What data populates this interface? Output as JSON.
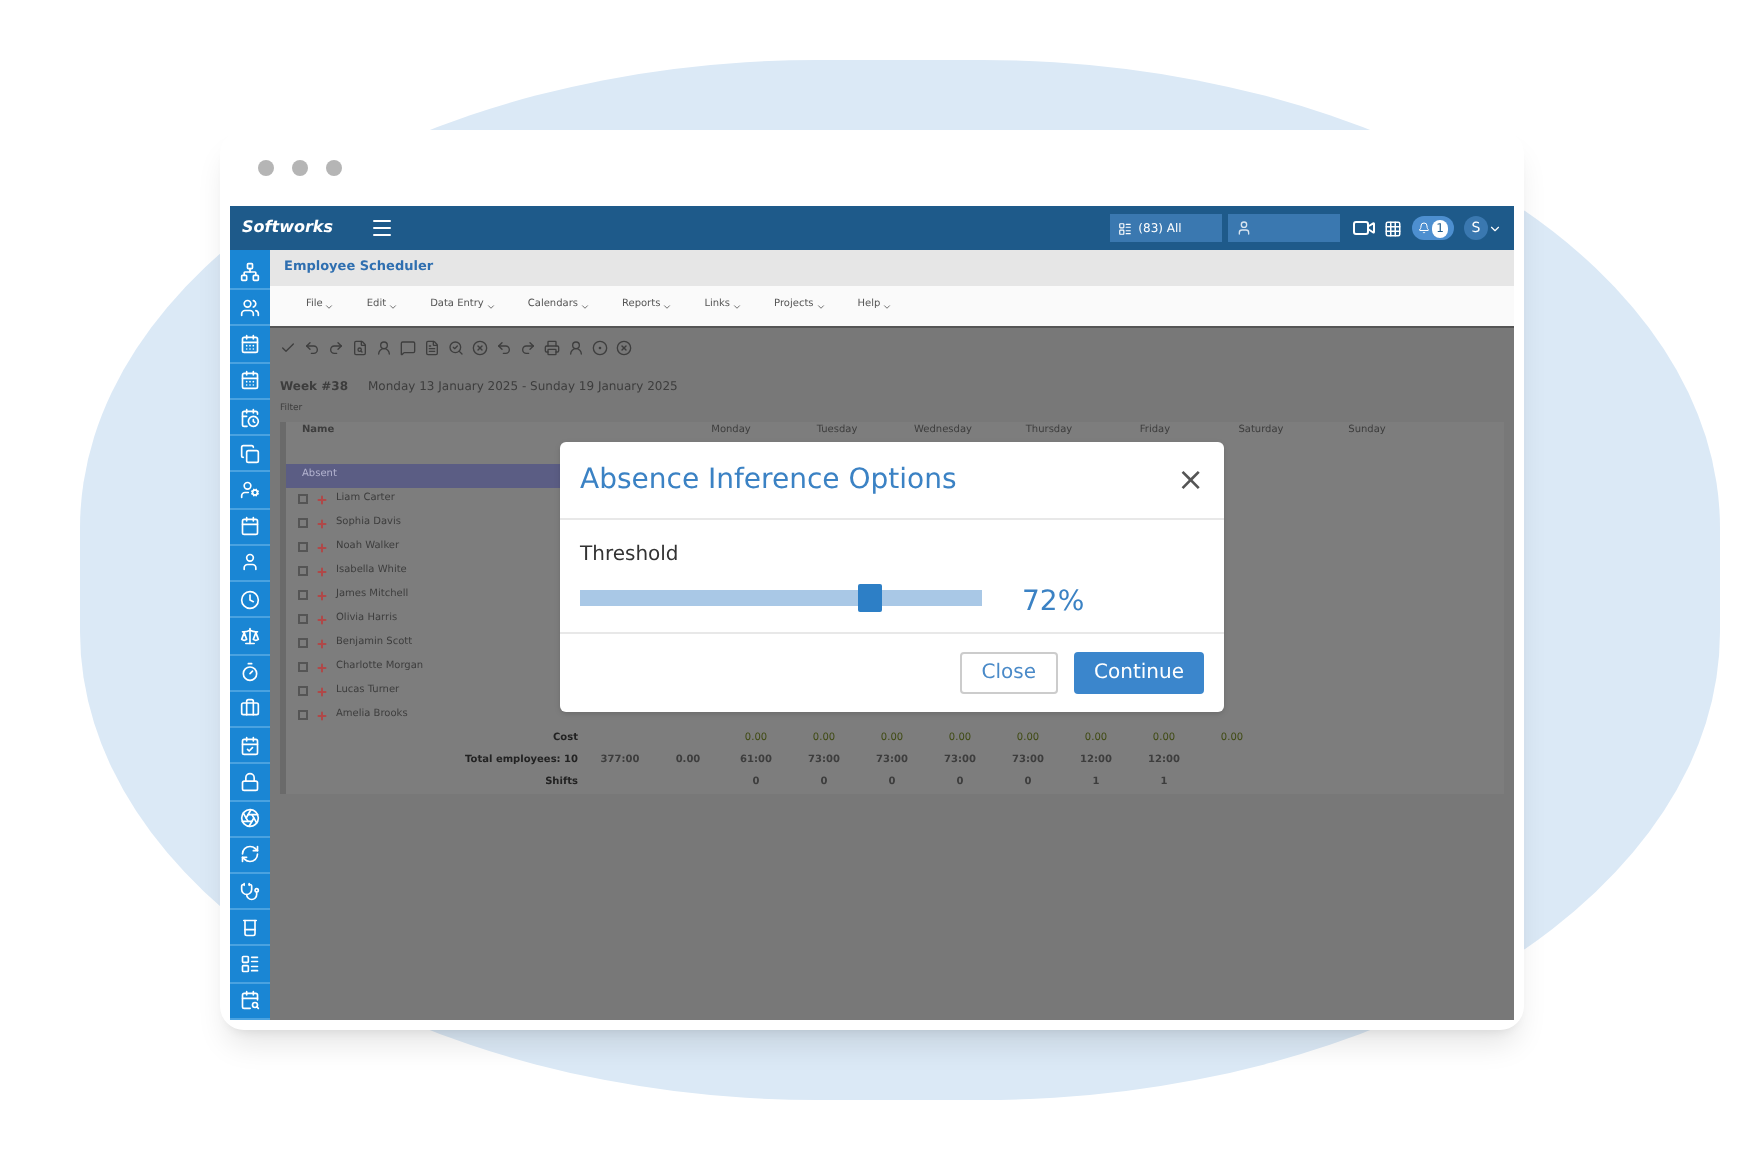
{
  "header": {
    "logo": "Softworks",
    "filter_select": "(83) All",
    "notification_count": "1",
    "user_initial": "S"
  },
  "app": {
    "title": "Employee Scheduler"
  },
  "menu": [
    "File",
    "Edit",
    "Data Entry",
    "Calendars",
    "Reports",
    "Links",
    "Projects",
    "Help"
  ],
  "week": {
    "number": "Week #38",
    "range": "Monday 13 January 2025 - Sunday 19 January 2025"
  },
  "filter_label": "Filter",
  "table": {
    "name_column": "Name",
    "days": [
      "Monday",
      "Tuesday",
      "Wednesday",
      "Thursday",
      "Friday",
      "Saturday",
      "Sunday"
    ],
    "group": "Absent",
    "rows": [
      {
        "name": "Liam Carter",
        "checked": false
      },
      {
        "name": "Sophia Davis",
        "checked": false
      },
      {
        "name": "Noah Walker",
        "checked": false
      },
      {
        "name": "Isabella White",
        "checked": false
      },
      {
        "name": "James Mitchell",
        "checked": false
      },
      {
        "name": "Olivia Harris",
        "checked": false
      },
      {
        "name": "Benjamin Scott",
        "checked": false
      },
      {
        "name": "Charlotte Morgan",
        "checked": false
      },
      {
        "name": "Lucas Turner",
        "checked": false
      },
      {
        "name": "Amelia Brooks",
        "checked": false
      }
    ],
    "summary": [
      {
        "label": "Cost",
        "days": [
          "0.00",
          "0.00",
          "0.00",
          "0.00",
          "0.00",
          "0.00",
          "0.00"
        ],
        "column_10": "0.00"
      },
      {
        "label": "Total employees: 10",
        "hours": "377:00",
        "column_2": "0.00",
        "days": [
          "61:00",
          "73:00",
          "73:00",
          "73:00",
          "73:00",
          "12:00",
          "12:00"
        ]
      },
      {
        "label": "Shifts",
        "days": [
          "0",
          "0",
          "0",
          "0",
          "0",
          "1",
          "1"
        ]
      }
    ]
  },
  "dialog": {
    "title": "Absence Inference Options",
    "close_glyph": "×",
    "slider_label": "Threshold",
    "level": 0.72,
    "reading": "72%",
    "buttons": [
      "Close",
      "Continue"
    ]
  }
}
